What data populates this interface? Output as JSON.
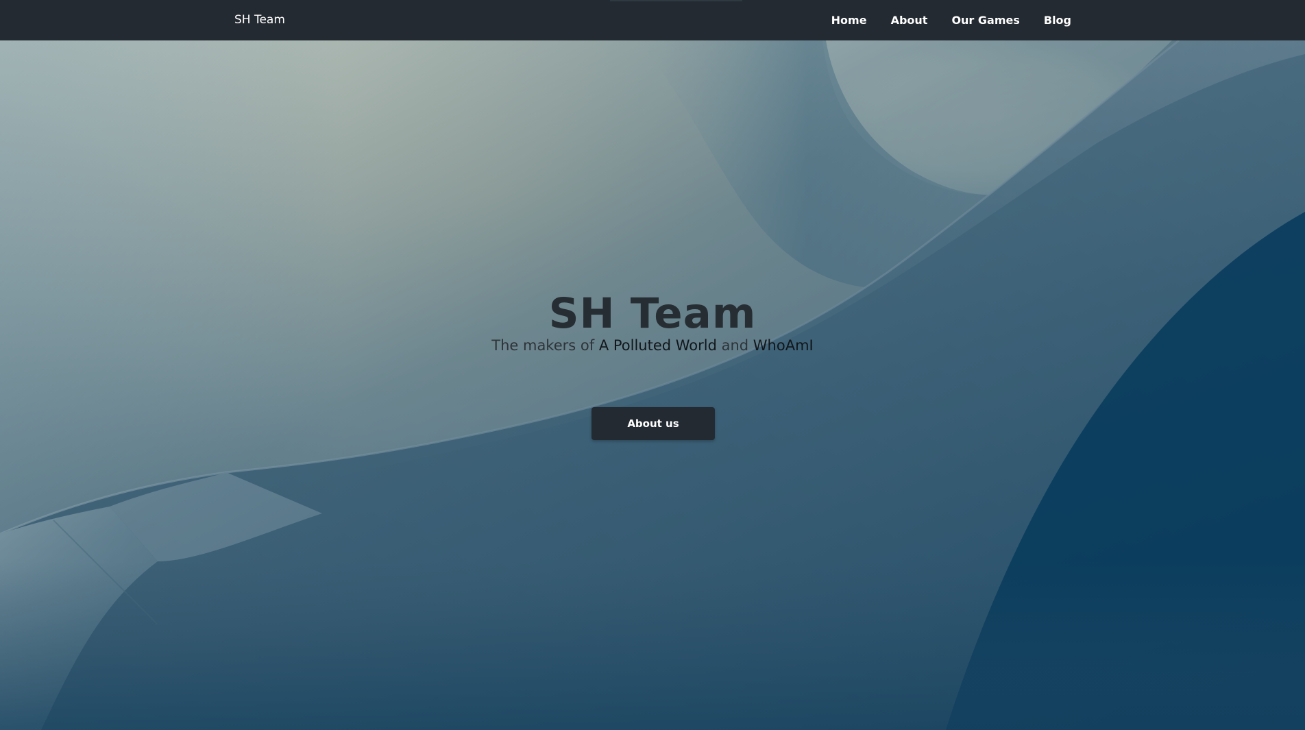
{
  "navbar": {
    "brand": "SH Team",
    "links": [
      {
        "label": "Home"
      },
      {
        "label": "About"
      },
      {
        "label": "Our Games"
      },
      {
        "label": "Blog"
      }
    ]
  },
  "hero": {
    "title": "SH Team",
    "subtitle_prefix": "The makers of ",
    "game_one": "A Polluted World",
    "subtitle_joiner": " and ",
    "game_two": "WhoAmI",
    "button_label": "About us"
  },
  "colors": {
    "navbar_bg": "#232a31",
    "button_bg": "#232a31",
    "title_text": "#262d33"
  }
}
